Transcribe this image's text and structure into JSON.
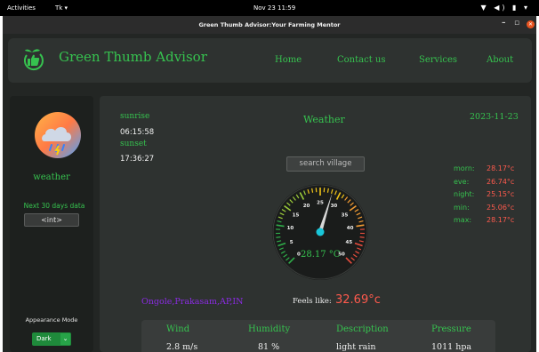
{
  "topbar": {
    "activities": "Activities",
    "app_menu": "Tk ▾",
    "clock": "Nov 23  11:59",
    "tray": "▼ ◀) ▮ ▾"
  },
  "window": {
    "title": "Green Thumb Advisor:Your Farming Mentor",
    "minimize": "–",
    "maximize": "▫",
    "close": "✕"
  },
  "header": {
    "brand": "Green Thumb Advisor",
    "nav": [
      "Home",
      "Contact us",
      "Services",
      "About"
    ]
  },
  "sidebar": {
    "weather_label": "weather",
    "next_days": "Next 30 days data",
    "int_button": "<int>",
    "appearance_label": "Appearance Mode",
    "appearance_value": "Dark",
    "appearance_chevron": "⌄"
  },
  "main": {
    "sunrise_label": "sunrise",
    "sunrise_time": "06:15:58",
    "sunset_label": "sunset",
    "sunset_time": "17:36:27",
    "title": "Weather",
    "date": "2023-11-23",
    "search_placeholder": "search village",
    "gauge": {
      "value": 28.17,
      "min": 0,
      "max": 50,
      "ticks": [
        "0",
        "5",
        "10",
        "15",
        "20",
        "25",
        "30",
        "35",
        "40",
        "45",
        "50"
      ],
      "reading": "28.17 °C"
    },
    "stats": [
      {
        "key": "morn:",
        "value": "28.17°c"
      },
      {
        "key": "eve:",
        "value": "26.74°c"
      },
      {
        "key": "night:",
        "value": "25.15°c"
      },
      {
        "key": "min:",
        "value": "25.06°c"
      },
      {
        "key": "max:",
        "value": "28.17°c"
      }
    ],
    "location": "Ongole,Prakasam,AP,IN",
    "feels_label": "Feels like:",
    "feels_value": "32.69°c",
    "info": [
      {
        "label": "Wind",
        "value": "2.8 m/s"
      },
      {
        "label": "Humidity",
        "value": "81 %"
      },
      {
        "label": "Description",
        "value": "light rain"
      },
      {
        "label": "Pressure",
        "value": "1011 hpa"
      }
    ]
  },
  "colors": {
    "accent_green": "#36c24f",
    "temperature_red": "#ff5a4d",
    "location_purple": "#8a2be2",
    "gauge_needle_dot": "#19c6d9"
  }
}
